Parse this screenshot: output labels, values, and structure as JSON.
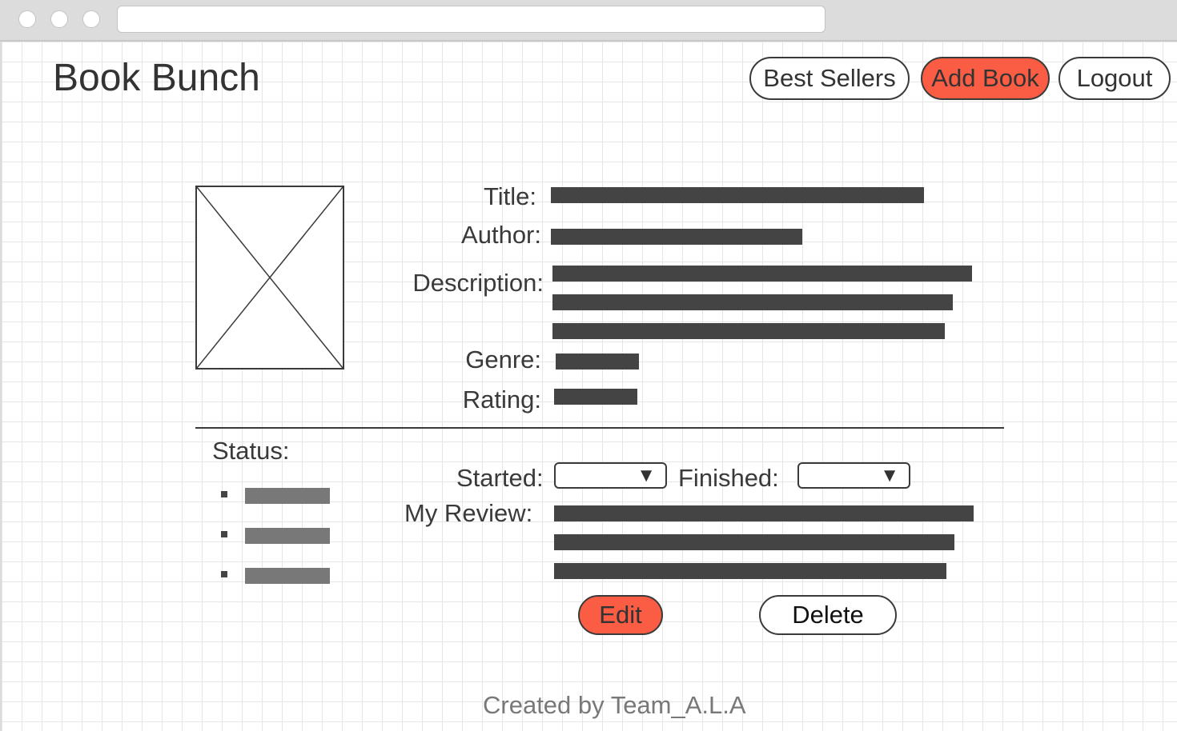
{
  "app": {
    "title": "Book Bunch"
  },
  "nav": {
    "best_sellers": "Best Sellers",
    "add_book": "Add Book",
    "logout": "Logout"
  },
  "book": {
    "title_label": "Title:",
    "author_label": "Author:",
    "description_label": "Description:",
    "genre_label": "Genre:",
    "rating_label": "Rating:"
  },
  "status": {
    "label": "Status:",
    "started_label": "Started:",
    "finished_label": "Finished:",
    "review_label": "My Review:",
    "dropdown_caret": "▼"
  },
  "actions": {
    "edit": "Edit",
    "delete": "Delete"
  },
  "footer": {
    "credit": "Created by Team_A.L.A"
  },
  "colors": {
    "accent": "#fa5d43",
    "text": "#3a3a3a",
    "placeholder_bar": "#444444",
    "placeholder_bar_light": "#787878",
    "grid": "#e6e6e6"
  },
  "icons": {
    "image_placeholder": "image-placeholder-icon",
    "dropdown": "chevron-down-icon",
    "bullet": "list-bullet-icon"
  }
}
